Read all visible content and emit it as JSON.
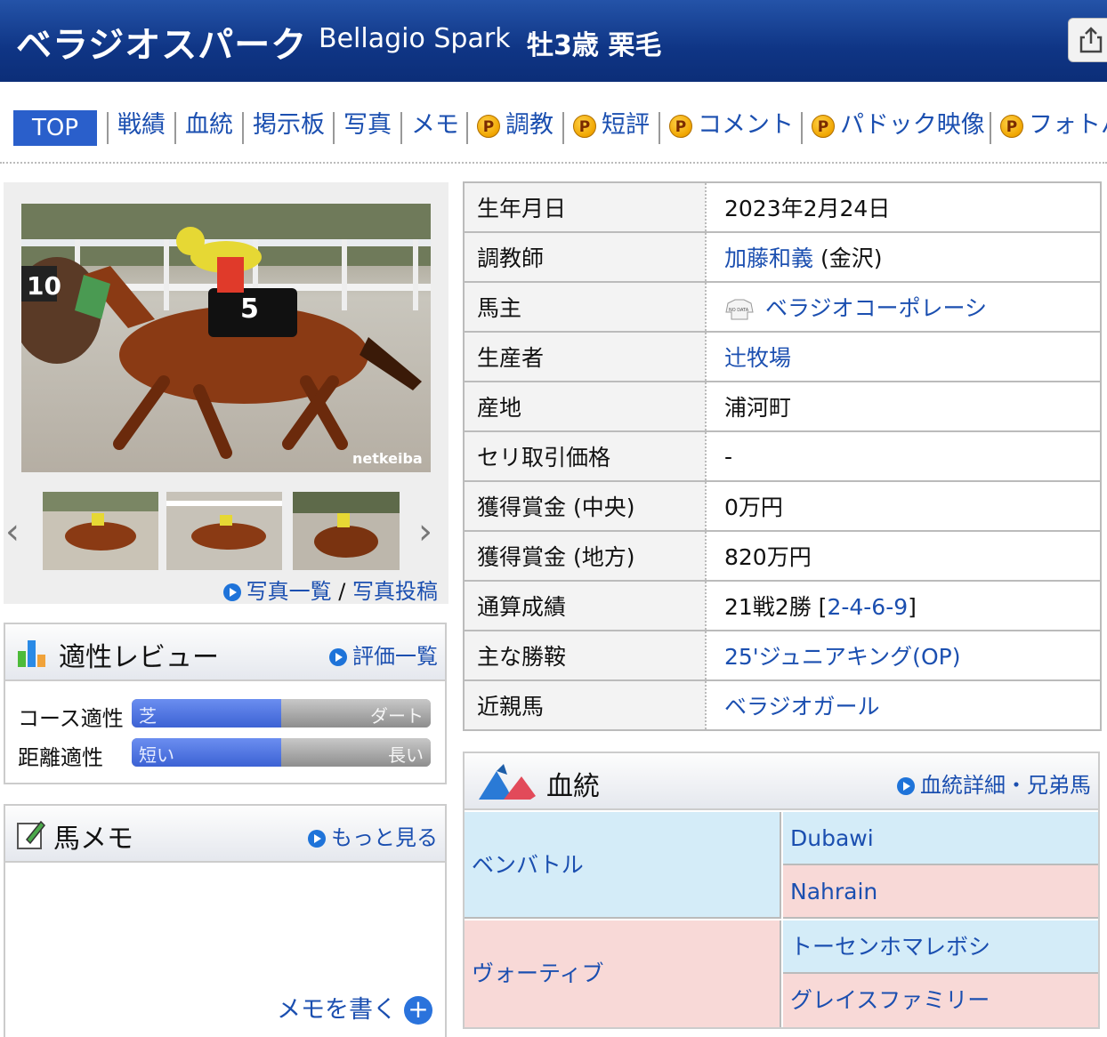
{
  "header": {
    "name_jp": "ベラジオスパーク",
    "name_en": "Bellagio Spark",
    "attributes": "牡3歳 栗毛",
    "share_icon": "share-icon"
  },
  "tabs": [
    {
      "label": "TOP",
      "premium": false
    },
    {
      "label": "戦績",
      "premium": false
    },
    {
      "label": "血統",
      "premium": false
    },
    {
      "label": "掲示板",
      "premium": false
    },
    {
      "label": "写真",
      "premium": false
    },
    {
      "label": "メモ",
      "premium": false
    },
    {
      "label": "調教",
      "premium": true
    },
    {
      "label": "短評",
      "premium": true
    },
    {
      "label": "コメント",
      "premium": true
    },
    {
      "label": "パドック映像",
      "premium": true
    },
    {
      "label": "フォトパ",
      "premium": true
    }
  ],
  "premium_mark": "P",
  "photo": {
    "watermark": "netkeiba",
    "saddle_number": "5",
    "links": {
      "list": "写真一覧",
      "sep": "/",
      "post": "写真投稿"
    }
  },
  "aptitude": {
    "title": "適性レビュー",
    "link": "評価一覧",
    "rows": [
      {
        "label": "コース適性",
        "left": "芝",
        "right": "ダート",
        "value": 0.5
      },
      {
        "label": "距離適性",
        "left": "短い",
        "right": "長い",
        "value": 0.5
      }
    ]
  },
  "memo": {
    "title": "馬メモ",
    "link": "もっと見る",
    "write": "メモを書く"
  },
  "profile": {
    "birth": {
      "label": "生年月日",
      "value": "2023年2月24日"
    },
    "trainer": {
      "label": "調教師",
      "name": "加藤和義",
      "suffix": "(金沢)"
    },
    "owner": {
      "label": "馬主",
      "value": "ベラジオコーポレーシ",
      "silks": "NO DATA"
    },
    "breeder": {
      "label": "生産者",
      "value": "辻牧場"
    },
    "origin": {
      "label": "産地",
      "value": "浦河町"
    },
    "auction": {
      "label": "セリ取引価格",
      "value": "-"
    },
    "prize_central": {
      "label": "獲得賞金 (中央)",
      "value": "0万円"
    },
    "prize_local": {
      "label": "獲得賞金 (地方)",
      "value": "820万円"
    },
    "record": {
      "label": "通算成績",
      "value": "21戦2勝",
      "detail": "2-4-6-9",
      "open": "[",
      "close": "]"
    },
    "main_win": {
      "label": "主な勝鞍",
      "value": "25'ジュニアキング(OP)"
    },
    "relatives": {
      "label": "近親馬",
      "value": "ベラジオガール"
    }
  },
  "pedigree": {
    "title": "血統",
    "link": "血統詳細・兄弟馬",
    "sire": "ベンバトル",
    "sire_sire": "Dubawi",
    "sire_dam": "Nahrain",
    "dam": "ヴォーティブ",
    "dam_sire": "トーセンホマレボシ",
    "dam_dam": "グレイスファミリー"
  }
}
